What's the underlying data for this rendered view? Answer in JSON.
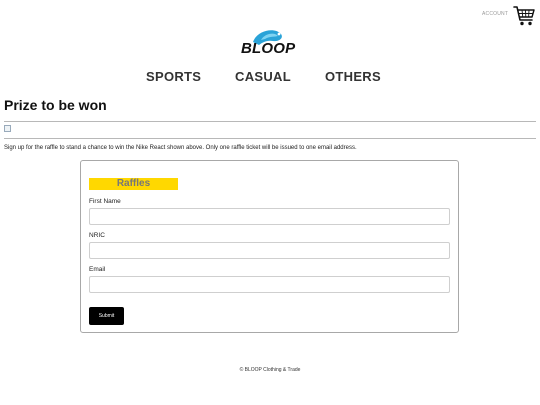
{
  "header": {
    "account_label": "ACCOUNT",
    "cart_icon": "shopping-cart-icon",
    "logo_text": "BLOOP",
    "logo_colors": {
      "wave": "#2aa3d8",
      "accent": "#7fd3f2"
    }
  },
  "nav": {
    "items": [
      "SPORTS",
      "CASUAL",
      "OTHERS"
    ]
  },
  "main": {
    "title": "Prize to be won",
    "intro": "Sign up for the raffle to stand a chance to win the Nike React shown above. Only one raffle ticket will be issued to one email address."
  },
  "form": {
    "title": "Raffles",
    "title_bg": "#ffd800",
    "fields": [
      {
        "label": "First Name",
        "value": ""
      },
      {
        "label": "NRIC",
        "value": ""
      },
      {
        "label": "Email",
        "value": ""
      }
    ],
    "submit_label": "Submit"
  },
  "footer": {
    "text": "© BLOOP Clothing & Trade"
  }
}
